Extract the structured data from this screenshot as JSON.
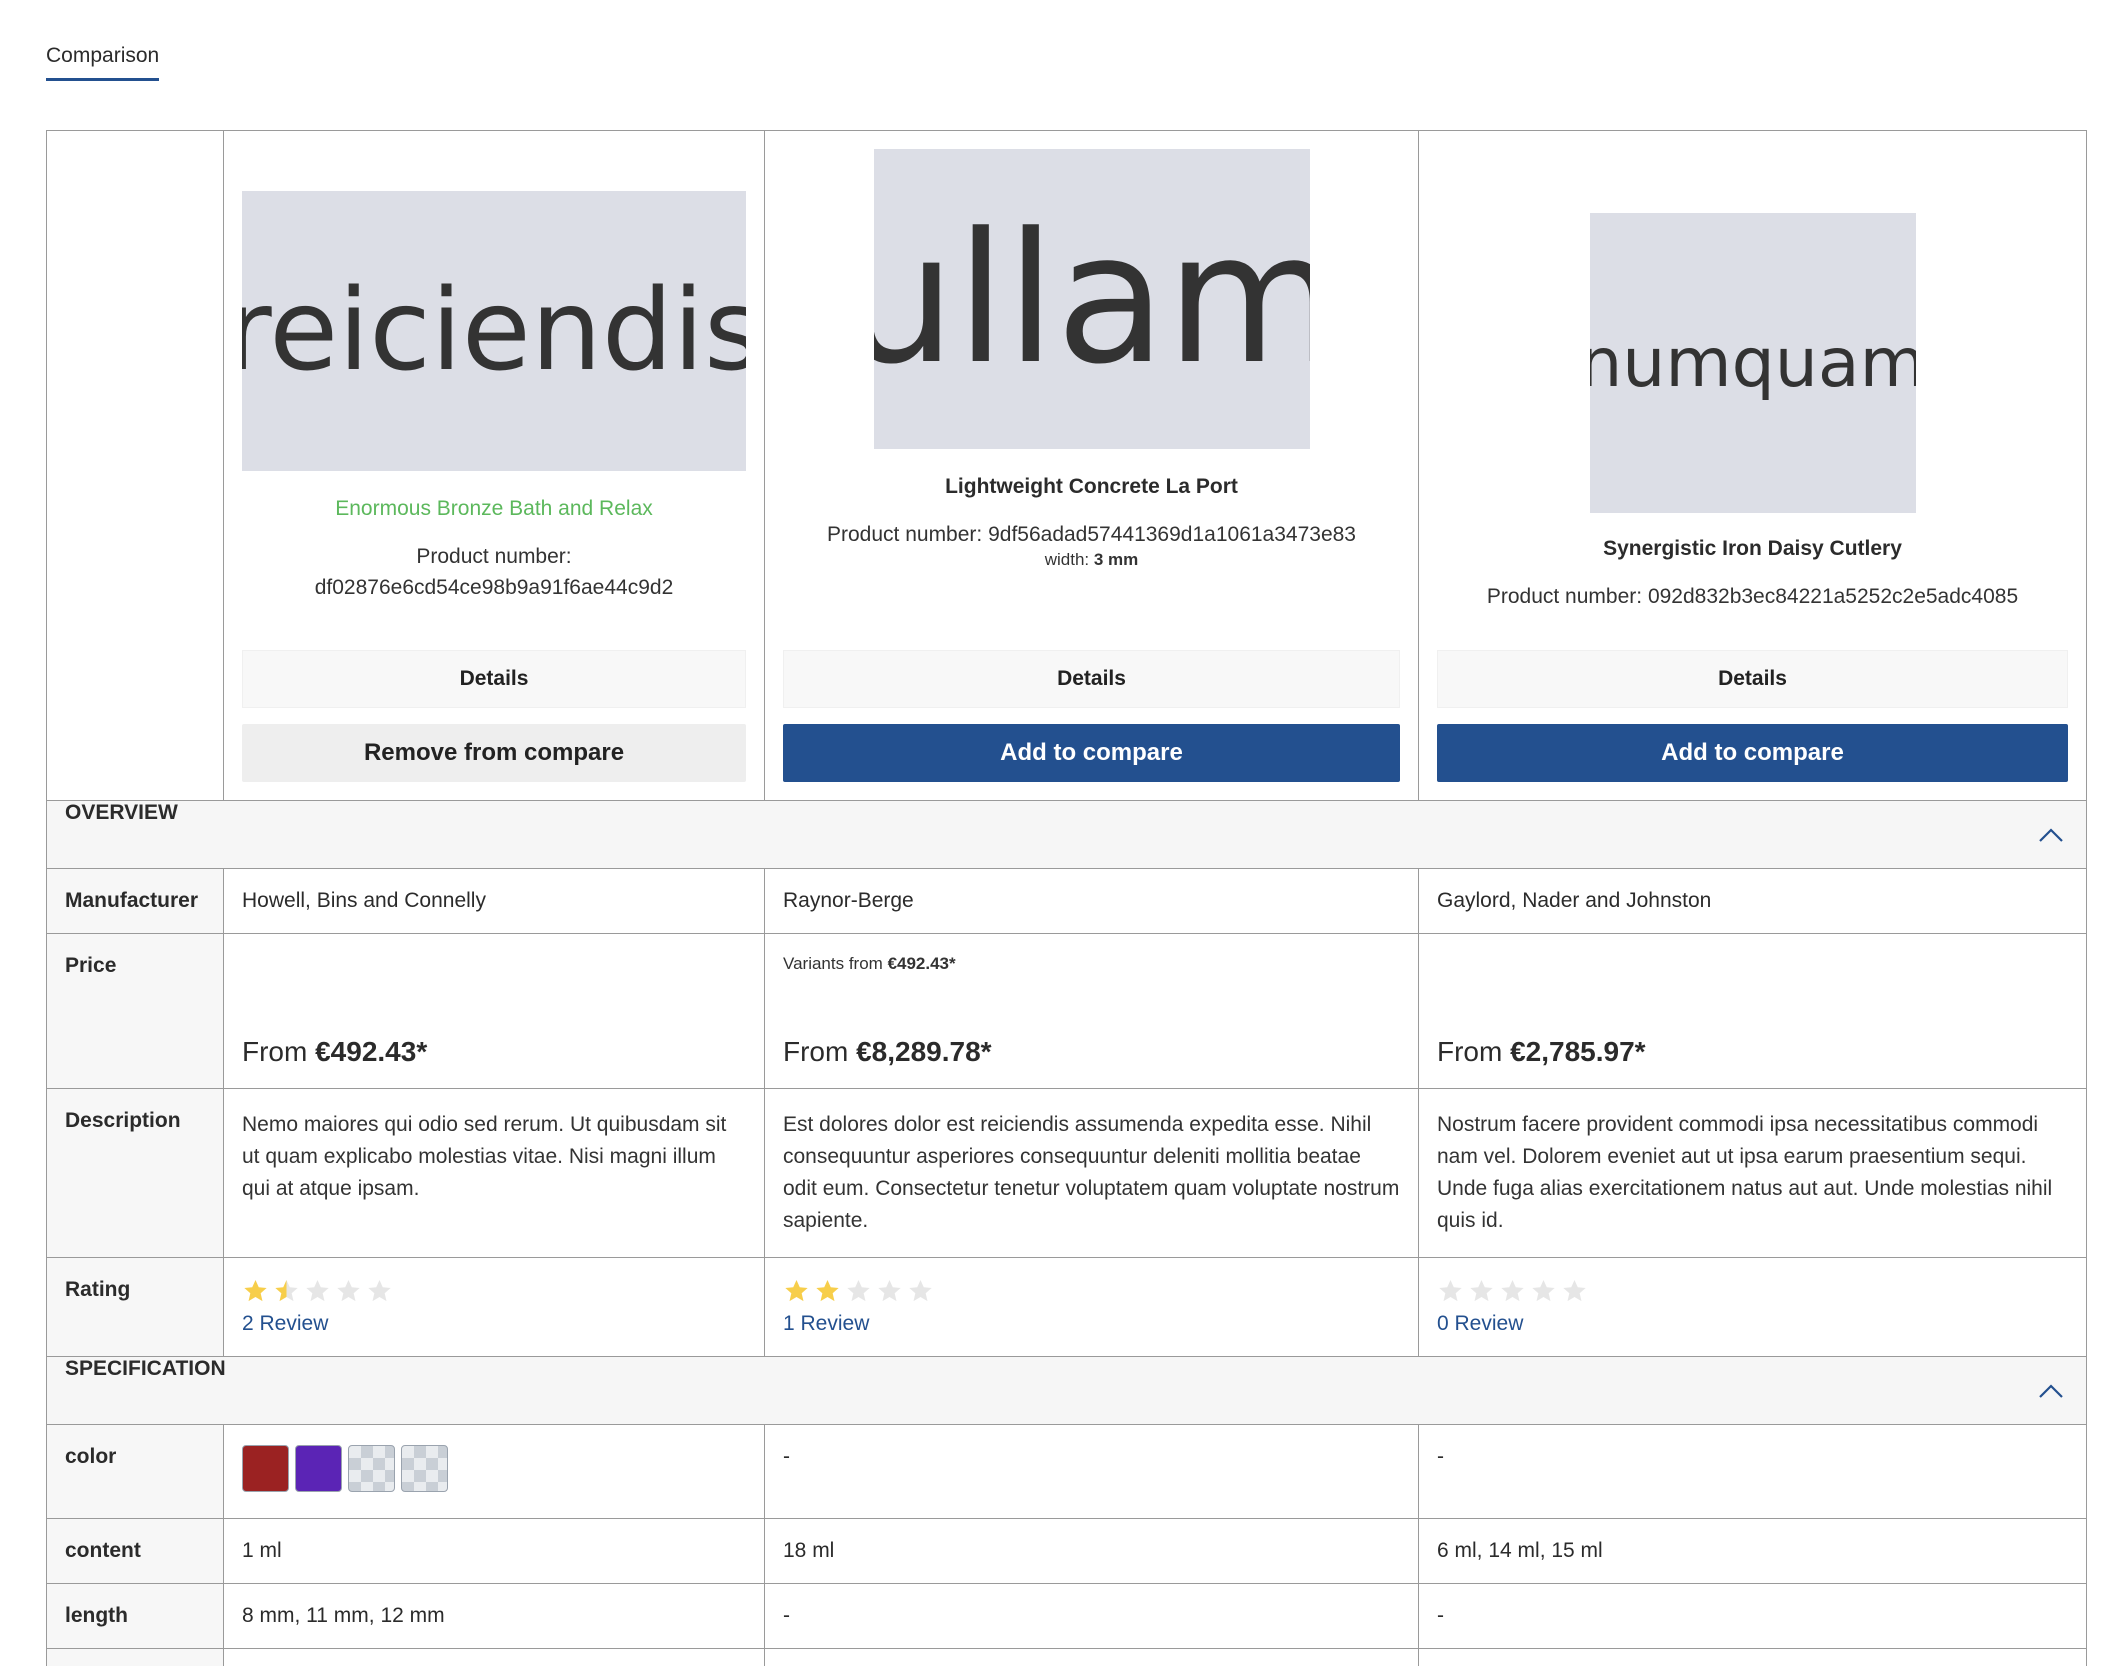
{
  "tabs": [
    {
      "label": "Comparison",
      "active": true
    }
  ],
  "sections": {
    "overview": "OVERVIEW",
    "specification": "SPECIFICATION"
  },
  "row_labels": {
    "manufacturer": "Manufacturer",
    "price": "Price",
    "description": "Description",
    "rating": "Rating",
    "color": "color",
    "content": "content",
    "length": "length"
  },
  "products": [
    {
      "image_text": "reiciendis",
      "name": "Enormous Bronze Bath and Relax",
      "product_number_label": "Product number:",
      "product_number": "df02876e6cd54ce98b9a91f6ae44c9d2",
      "details_label": "Details",
      "compare_label": "Remove from compare",
      "manufacturer": "Howell, Bins and Connelly",
      "variants_prefix": "",
      "variants_price": "",
      "price_prefix": "From ",
      "price": "€492.43*",
      "description": "Nemo maiores qui odio sed rerum. Ut quibusdam sit ut quam explicabo molestias vitae. Nisi magni illum qui at atque ipsam.",
      "rating": 1.5,
      "review_text": "2 Review",
      "colors": [
        "#9b2222",
        "#5b24b5",
        "checker",
        "checker"
      ],
      "content": "1 ml",
      "length": "8 mm, 11 mm, 12 mm"
    },
    {
      "image_text": "ullam",
      "name": "Lightweight Concrete La Port",
      "product_number_label": "Product number:",
      "product_number": "9df56adad57441369d1a1061a3473e83",
      "variant_label": "width: ",
      "variant_value": "3 mm",
      "details_label": "Details",
      "compare_label": "Add to compare",
      "manufacturer": "Raynor-Berge",
      "variants_prefix": "Variants from ",
      "variants_price": "€492.43*",
      "price_prefix": "From ",
      "price": "€8,289.78*",
      "description": "Est dolores dolor est reiciendis assumenda expedita esse. Nihil consequuntur asperiores consequuntur deleniti mollitia beatae odit eum. Consectetur tenetur voluptatem quam voluptate nostrum sapiente.",
      "rating": 2,
      "review_text": "1 Review",
      "color_text": "-",
      "content": "18 ml",
      "length": "-"
    },
    {
      "image_text": "numquam",
      "name": "Synergistic Iron Daisy Cutlery",
      "product_number_label": "Product number:",
      "product_number": "092d832b3ec84221a5252c2e5adc4085",
      "details_label": "Details",
      "compare_label": "Add to compare",
      "manufacturer": "Gaylord, Nader and Johnston",
      "variants_prefix": "",
      "variants_price": "",
      "price_prefix": "From ",
      "price": "€2,785.97*",
      "description": "Nostrum facere provident commodi ipsa necessitatibus commodi nam vel. Dolorem eveniet aut ut ipsa earum praesentium sequi. Unde fuga alias exercitationem natus aut aut. Unde molestias nihil quis id.",
      "rating": 0,
      "review_text": "0 Review",
      "color_text": "-",
      "content": "6 ml, 14 ml, 15 ml",
      "length": "-"
    }
  ],
  "colors": {
    "accent": "#23508f",
    "star_filled": "#f7ce4a",
    "star_empty": "#e6e6e6",
    "green_title": "#5cb85c"
  },
  "max_rating": 5
}
